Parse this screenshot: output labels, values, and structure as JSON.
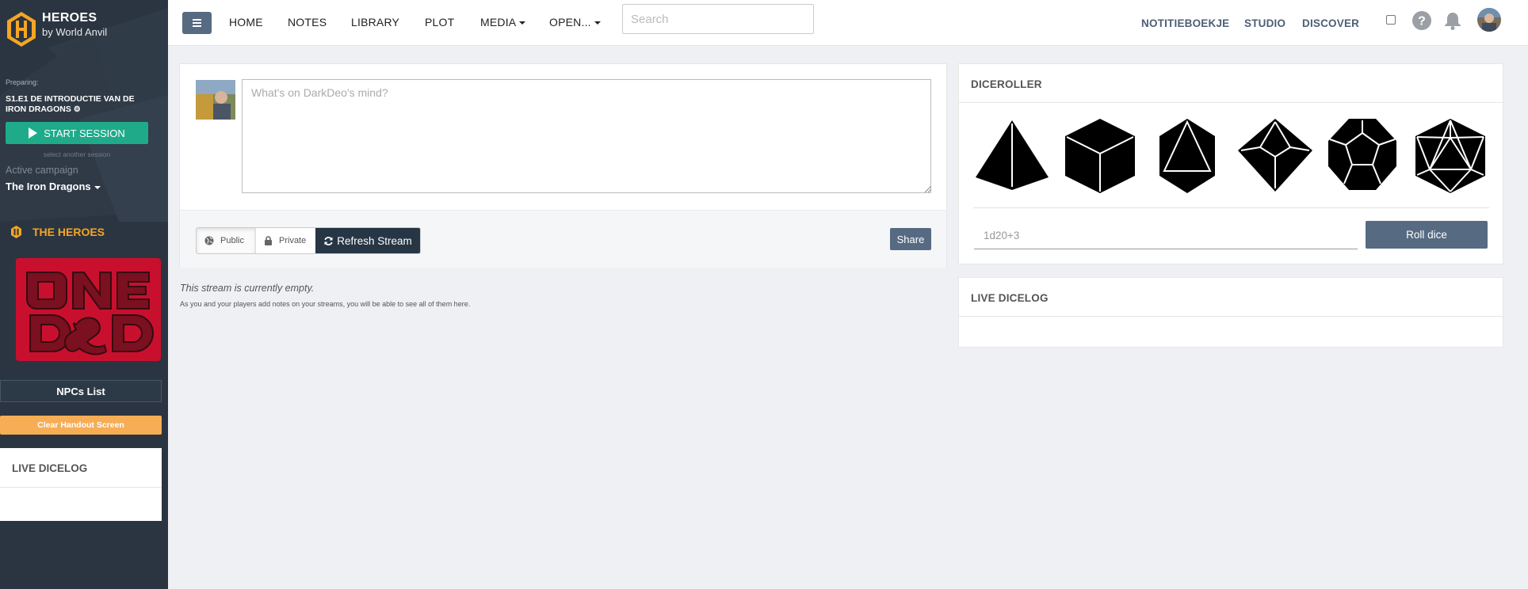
{
  "brand": {
    "title": "HEROES",
    "subtitle": "by World Anvil"
  },
  "sidebar": {
    "preparing_label": "Preparing:",
    "session_title": "S1.E1 DE INTRODUCTIE VAN DE IRON DRAGONS",
    "start_session_label": "START SESSION",
    "select_session_label": "select another session",
    "active_campaign_label": "Active campaign",
    "campaign_name": "The Iron Dragons",
    "heroes_heading": "THE HEROES",
    "npcs_label": "NPCs List",
    "clear_handout_label": "Clear Handout Screen",
    "dicelog_heading": "LIVE DICELOG"
  },
  "nav": {
    "items": [
      "HOME",
      "NOTES",
      "LIBRARY",
      "PLOT",
      "MEDIA",
      "OPEN..."
    ],
    "search_placeholder": "Search",
    "right_items": [
      "NOTITIEBOEKJE",
      "STUDIO",
      "DISCOVER"
    ]
  },
  "stream": {
    "placeholder": "What's on DarkDeo's mind?",
    "public_label": "Public",
    "private_label": "Private",
    "refresh_label": "Refresh Stream",
    "share_label": "Share",
    "empty_title": "This stream is currently empty.",
    "empty_sub": "As you and your players add notes on your streams, you will be able to see all of them here."
  },
  "diceroller": {
    "heading": "DICEROLLER",
    "dice": [
      "d4-icon",
      "d6-icon",
      "d8-icon",
      "d10-icon",
      "d12-icon",
      "d20-icon"
    ],
    "input_placeholder": "1d20+3",
    "roll_label": "Roll dice"
  },
  "dicelog": {
    "heading": "LIVE DICELOG"
  },
  "colors": {
    "sidebar_bg": "#2b3541",
    "accent_green": "#1fab8a",
    "accent_orange": "#f5a623",
    "button_slate": "#566a82",
    "dnd_red": "#c8102e"
  }
}
